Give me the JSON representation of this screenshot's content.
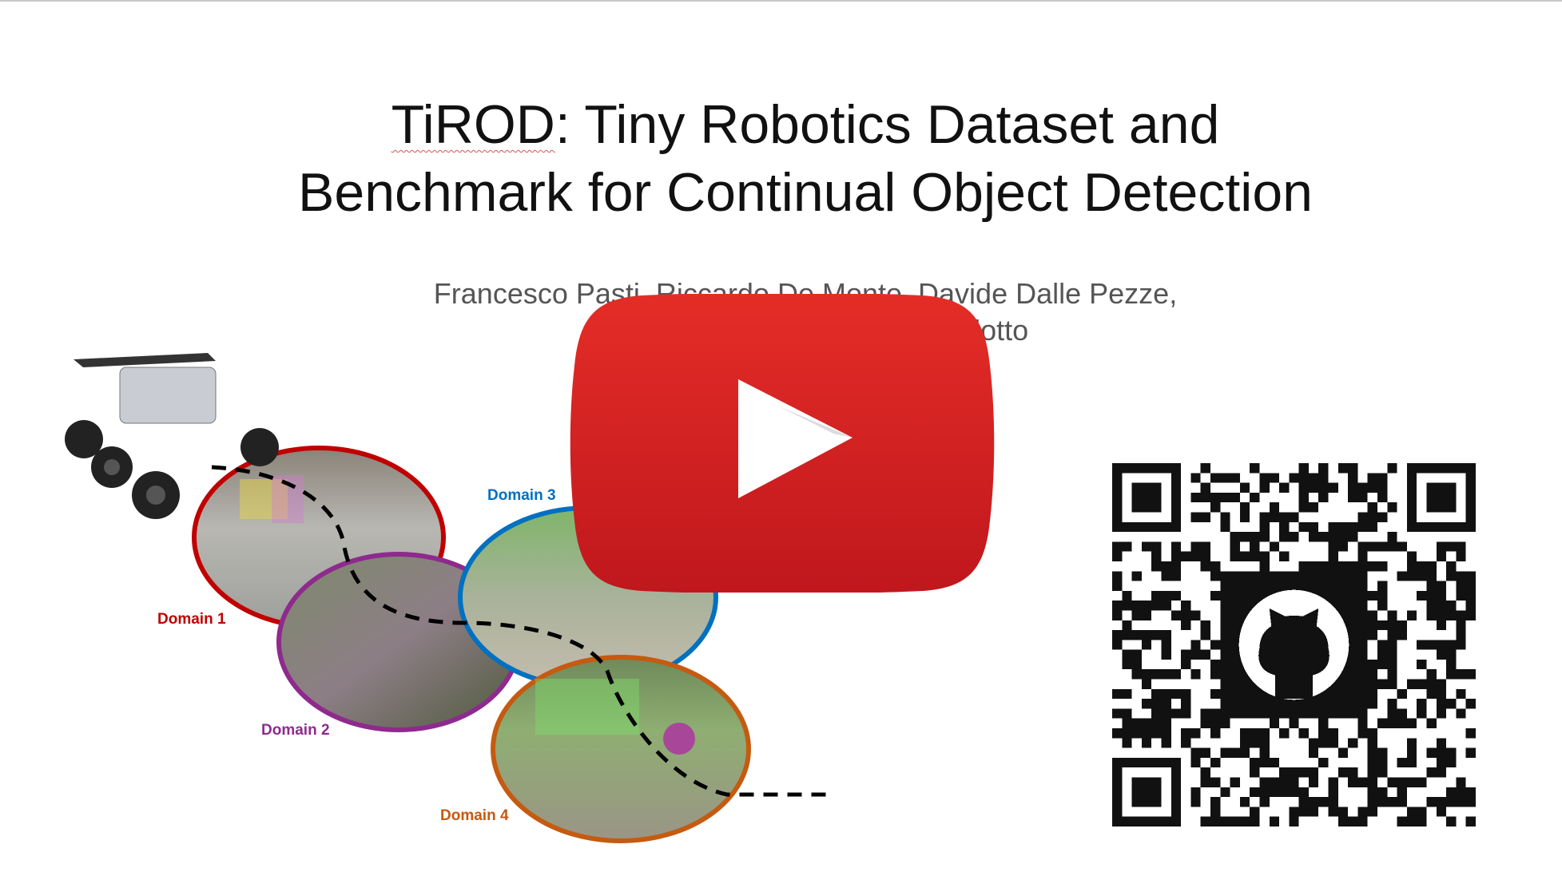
{
  "slide": {
    "title_line1_prefix": "TiROD",
    "title_line1_rest": ": Tiny Robotics Dataset and",
    "title_line2": "Benchmark for Continual Object Detection",
    "authors_line1": "Francesco Pasti, Riccardo De Monte, Davide Dalle Pezze,",
    "authors_line2": "Gian Antonio Susto, Nicola Bellotto"
  },
  "figure": {
    "domains": [
      {
        "label": "Domain 1",
        "color": "#c00000"
      },
      {
        "label": "Domain 2",
        "color": "#8e2a8e"
      },
      {
        "label": "Domain 3",
        "color": "#0070c0"
      },
      {
        "label": "Domain 4",
        "color": "#c55a11"
      }
    ]
  },
  "video": {
    "icon": "youtube-play-icon",
    "color": "#e12a27"
  },
  "qr": {
    "icon": "github-icon"
  }
}
